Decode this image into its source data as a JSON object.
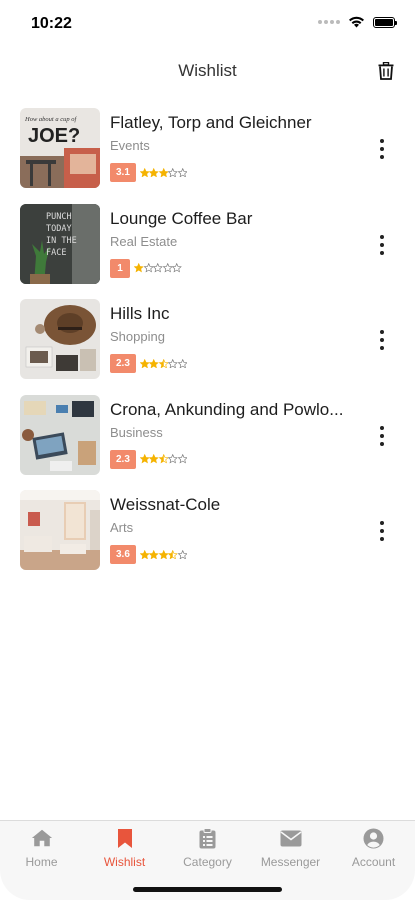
{
  "status_bar": {
    "time": "10:22"
  },
  "header": {
    "title": "Wishlist",
    "delete_icon": "trash-icon"
  },
  "items": [
    {
      "title": "Flatley, Torp and Gleichner",
      "category": "Events",
      "rating": "3.1",
      "rating_value": 3.1,
      "thumb_text_top": "How about a cup of",
      "thumb_text_main": "JOE?"
    },
    {
      "title": "Lounge Coffee Bar",
      "category": "Real Estate",
      "rating": "1",
      "rating_value": 1,
      "thumb_text": "PUNCH TODAY IN THE FACE"
    },
    {
      "title": "Hills Inc",
      "category": "Shopping",
      "rating": "2.3",
      "rating_value": 2.3
    },
    {
      "title": "Crona, Ankunding and Powlo...",
      "category": "Business",
      "rating": "2.3",
      "rating_value": 2.3
    },
    {
      "title": "Weissnat-Cole",
      "category": "Arts",
      "rating": "3.6",
      "rating_value": 3.6
    }
  ],
  "tabs": [
    {
      "label": "Home",
      "icon": "home-icon",
      "active": false
    },
    {
      "label": "Wishlist",
      "icon": "bookmark-icon",
      "active": true
    },
    {
      "label": "Category",
      "icon": "clipboard-list-icon",
      "active": false
    },
    {
      "label": "Messenger",
      "icon": "envelope-icon",
      "active": false
    },
    {
      "label": "Account",
      "icon": "user-circle-icon",
      "active": false
    }
  ],
  "colors": {
    "accent": "#e8553c",
    "badge": "#f28a6b",
    "star": "#f5b301",
    "inactive": "#9a9a9a"
  }
}
